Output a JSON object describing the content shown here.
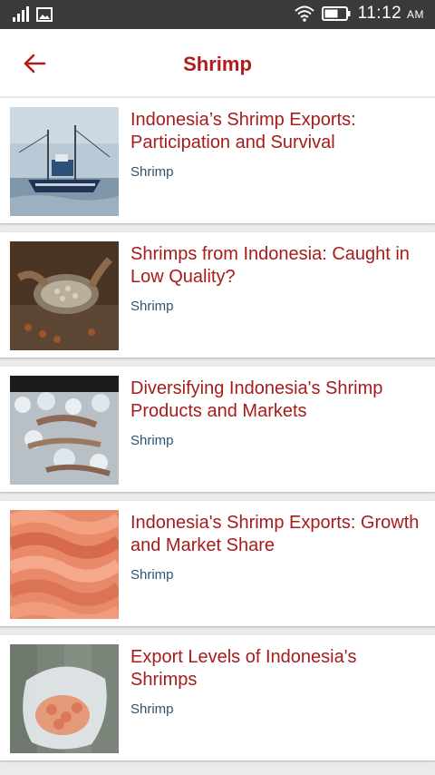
{
  "status_bar": {
    "time": "11:12",
    "ampm": "AM",
    "icons": [
      "signal-icon",
      "gallery-icon",
      "wifi-icon",
      "battery-icon"
    ]
  },
  "app_bar": {
    "back_icon": "arrow-back-icon",
    "title": "Shrimp"
  },
  "colors": {
    "accent": "#b01c1c",
    "category": "#2f5470",
    "status_bar": "#3a3a3a",
    "background": "#eceaea"
  },
  "articles": [
    {
      "title": "Indonesia’s Shrimp Exports: Participation and Survival",
      "category": "Shrimp",
      "image": "fishing-boat-photo"
    },
    {
      "title": "Shrimps from Indonesia: Caught in Low Quality?",
      "category": "Shrimp",
      "image": "sorting-shrimp-photo"
    },
    {
      "title": "Diversifying Indonesia's Shrimp Products and Markets",
      "category": "Shrimp",
      "image": "shrimp-on-ice-photo"
    },
    {
      "title": "Indonesia's Shrimp Exports: Growth and Market Share",
      "category": "Shrimp",
      "image": "cooked-shrimp-photo"
    },
    {
      "title": "Export Levels of Indonesia's Shrimps",
      "category": "Shrimp",
      "image": "bagged-shrimp-photo"
    }
  ]
}
